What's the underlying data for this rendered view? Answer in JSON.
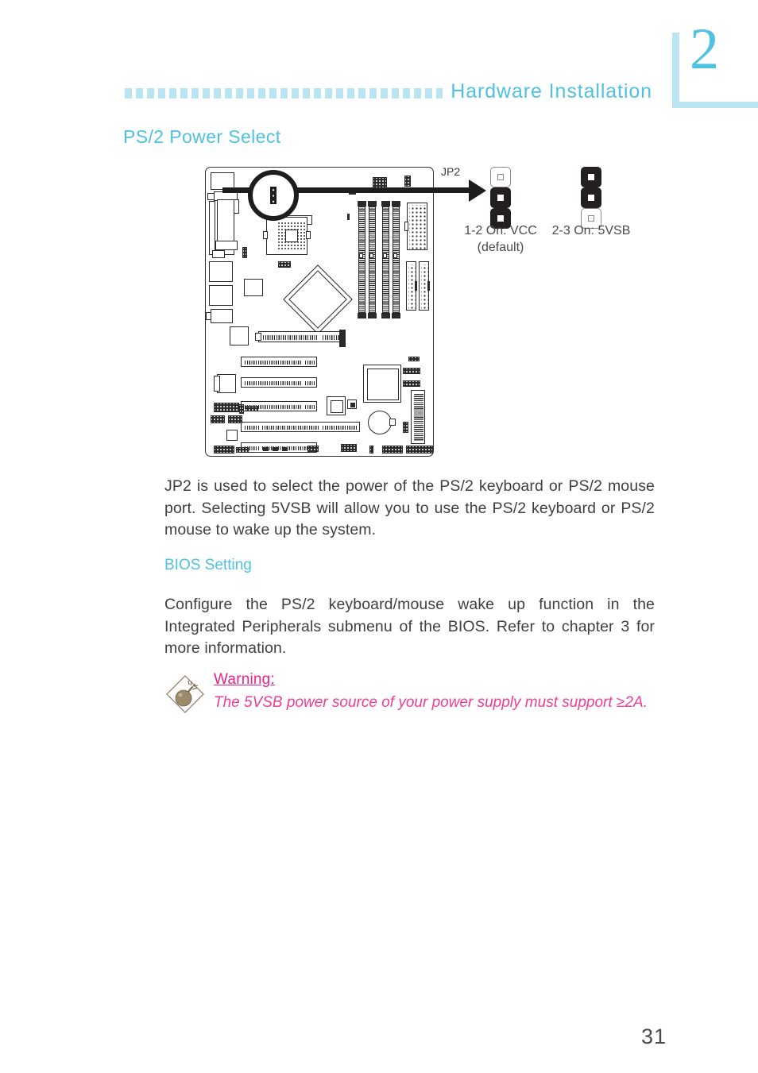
{
  "header": {
    "title": "Hardware  Installation",
    "chapter_number": "2"
  },
  "section": {
    "title": "PS/2 Power Select"
  },
  "figure": {
    "callout_label": "JP2",
    "jumpers": [
      {
        "caption_line1": "1-2 On: VCC",
        "caption_line2": "(default)",
        "pins": [
          "off",
          "on",
          "on"
        ]
      },
      {
        "caption_line1": "2-3 On: 5VSB",
        "caption_line2": "",
        "pins": [
          "on",
          "on",
          "off"
        ]
      }
    ]
  },
  "body": {
    "paragraph_1": "JP2 is used to select the power of the PS/2 keyboard or PS/2 mouse port. Selecting 5VSB will allow you to use the PS/2 keyboard or PS/2 mouse to wake up the system.",
    "bios_heading": "BIOS Setting",
    "paragraph_2": "Configure the PS/2 keyboard/mouse wake up function in the Integrated Peripherals submenu of the BIOS. Refer to chapter 3 for more information."
  },
  "warning": {
    "title": "Warning:",
    "text": "The 5VSB power source of your power supply must support ≥2A.",
    "icon": "bomb-icon",
    "title_color": "#ec2085",
    "text_color": "#ee3d96"
  },
  "footer": {
    "page_number": "31"
  },
  "colors": {
    "accent_cyan": "#4ec2e0",
    "accent_light_cyan": "#b9e4f2",
    "body_text": "#3f3f3f"
  }
}
